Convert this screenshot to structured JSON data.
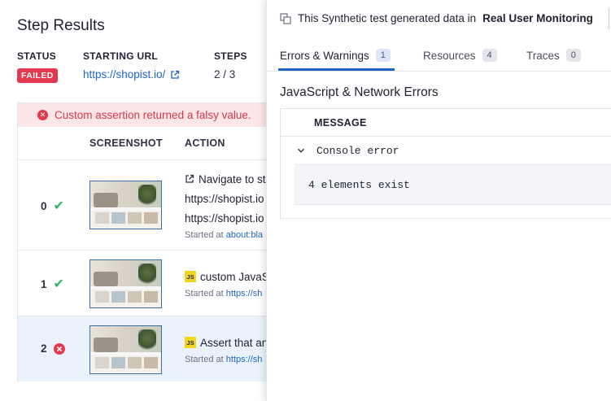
{
  "page": {
    "title": "Step Results"
  },
  "meta": {
    "status_label": "STATUS",
    "status_value": "FAILED",
    "url_label": "STARTING URL",
    "url_value": "https://shopist.io/",
    "steps_label": "STEPS",
    "steps_value": "2 / 3"
  },
  "table": {
    "error_banner": "Custom assertion returned a falsy value.",
    "headers": {
      "screenshot": "SCREENSHOT",
      "action": "ACTION"
    },
    "rows": [
      {
        "index": "0",
        "status": "passed",
        "action_line1": "Navigate to st",
        "action_line2": "https://shopist.io",
        "action_line3": "https://shopist.io",
        "started_label": "Started at",
        "started_value": "about:bla"
      },
      {
        "index": "1",
        "status": "passed",
        "badge": "JS",
        "action_line1": "custom JavaSc",
        "started_label": "Started at",
        "started_value": "https://sh"
      },
      {
        "index": "2",
        "status": "failed",
        "badge": "JS",
        "action_line1": "Assert that an",
        "started_label": "Started at",
        "started_value": "https://sh"
      }
    ]
  },
  "panel": {
    "header_text": "This Synthetic test generated data in",
    "header_bold": "Real User Monitoring",
    "tabs": [
      {
        "label": "Errors & Warnings",
        "count": "1",
        "active": true
      },
      {
        "label": "Resources",
        "count": "4",
        "active": false
      },
      {
        "label": "Traces",
        "count": "0",
        "active": false
      }
    ],
    "section_title": "JavaScript & Network Errors",
    "message_header": "MESSAGE",
    "error_title": "Console error",
    "error_detail": "4 elements exist"
  },
  "colors": {
    "accent": "#1d64c1",
    "danger": "#e5384f",
    "success": "#2fb45a",
    "js_badge": "#f5d61e"
  },
  "icons": {
    "external_link": "external-link-icon",
    "error": "x-circle-icon",
    "check": "check-icon",
    "chevron": "chevron-down-icon",
    "synthetics": "synthetics-icon"
  }
}
